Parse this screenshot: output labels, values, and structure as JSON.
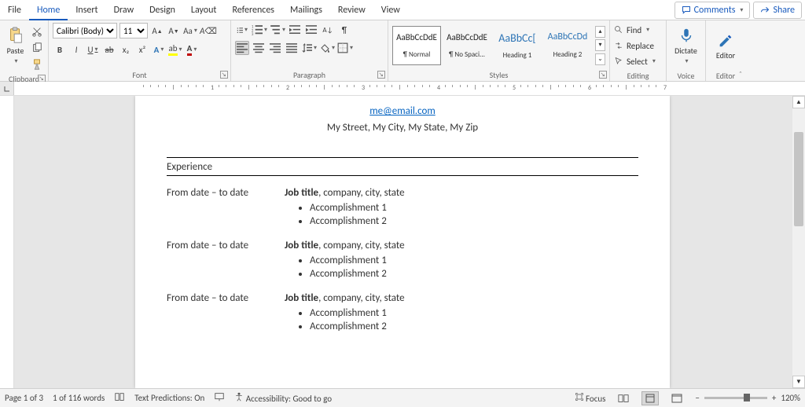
{
  "menu": {
    "tabs": [
      "File",
      "Home",
      "Insert",
      "Draw",
      "Design",
      "Layout",
      "References",
      "Mailings",
      "Review",
      "View"
    ],
    "active": 1,
    "comments": "Comments",
    "share": "Share"
  },
  "ribbon": {
    "clipboard": {
      "label": "Clipboard",
      "paste": "Paste"
    },
    "font": {
      "label": "Font",
      "name": "Calibri (Body)",
      "size": "11",
      "bold": "B",
      "italic": "I",
      "underline": "U",
      "strike": "ab",
      "sub": "x₂",
      "sup": "x²"
    },
    "paragraph": {
      "label": "Paragraph"
    },
    "styles": {
      "label": "Styles",
      "items": [
        {
          "preview": "AaBbCcDdE",
          "name": "¶ Normal"
        },
        {
          "preview": "AaBbCcDdE",
          "name": "¶ No Spaci..."
        },
        {
          "preview": "AaBbCc[",
          "name": "Heading 1"
        },
        {
          "preview": "AaBbCcDd",
          "name": "Heading 2"
        }
      ]
    },
    "editing": {
      "label": "Editing",
      "find": "Find",
      "replace": "Replace",
      "select": "Select"
    },
    "voice": {
      "label": "Voice",
      "dictate": "Dictate"
    },
    "editor": {
      "label": "Editor",
      "editor": "Editor"
    }
  },
  "document": {
    "email": "me@email.com",
    "address": "My Street, My City, My State, My Zip",
    "section": "Experience",
    "jobs": [
      {
        "dates": "From date – to date",
        "title": "Job title",
        "rest": ", company, city, state",
        "acc": [
          "Accomplishment 1",
          "Accomplishment 2"
        ]
      },
      {
        "dates": "From date – to date",
        "title": "Job title",
        "rest": ", company, city, state",
        "acc": [
          "Accomplishment 1",
          "Accomplishment 2"
        ]
      },
      {
        "dates": "From date – to date",
        "title": "Job title",
        "rest": ", company, city, state",
        "acc": [
          "Accomplishment 1",
          "Accomplishment 2"
        ]
      }
    ]
  },
  "status": {
    "page": "Page 1 of 3",
    "words": "1 of 116 words",
    "predictions": "Text Predictions: On",
    "accessibility": "Accessibility: Good to go",
    "focus": "Focus",
    "zoom": "120%"
  },
  "ruler": {
    "marks": [
      "1",
      "2",
      "3",
      "4",
      "5",
      "6",
      "7"
    ]
  }
}
